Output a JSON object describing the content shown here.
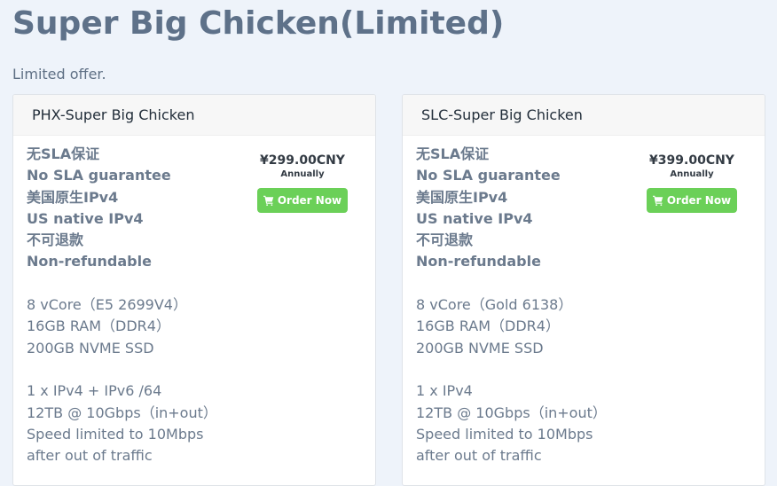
{
  "page": {
    "title": "Super Big Chicken(Limited)",
    "subtitle": "Limited offer."
  },
  "products": [
    {
      "name": "PHX-Super Big Chicken",
      "price": "¥299.00CNY",
      "cycle": "Annually",
      "order_label": "Order Now",
      "bold_features": [
        "无SLA保证",
        "No SLA guarantee",
        "美国原生IPv4",
        "US native IPv4",
        "不可退款",
        "Non-refundable"
      ],
      "specs": [
        "8 vCore（E5 2699V4）",
        "16GB RAM（DDR4）",
        "200GB NVME SSD"
      ],
      "network": [
        "1 x IPv4 + IPv6 /64",
        "12TB @ 10Gbps（in+out）",
        "Speed limited to 10Mbps",
        "after out of traffic"
      ]
    },
    {
      "name": "SLC-Super Big Chicken",
      "price": "¥399.00CNY",
      "cycle": "Annually",
      "order_label": "Order Now",
      "bold_features": [
        "无SLA保证",
        "No SLA guarantee",
        "美国原生IPv4",
        "US native IPv4",
        "不可退款",
        "Non-refundable"
      ],
      "specs": [
        "8 vCore（Gold 6138）",
        "16GB RAM（DDR4）",
        "200GB NVME SSD"
      ],
      "network": [
        "1 x IPv4",
        "12TB @ 10Gbps（in+out）",
        "Speed limited to 10Mbps",
        "after out of traffic"
      ]
    }
  ],
  "colors": {
    "background": "#eef3fa",
    "button": "#6bd058",
    "title": "#5e7189"
  },
  "icons": {
    "order": "shopping-cart-icon"
  }
}
